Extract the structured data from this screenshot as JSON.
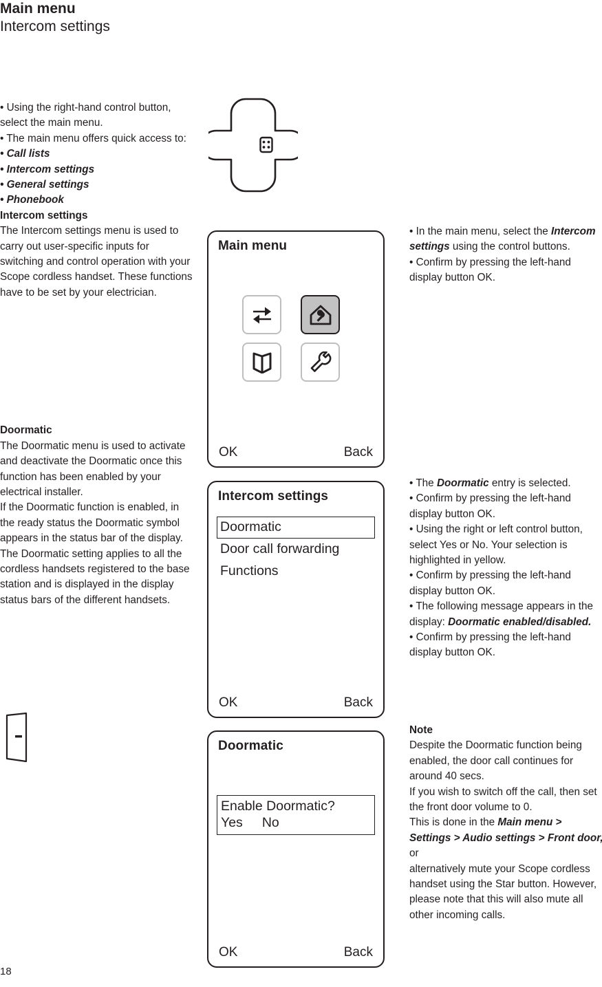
{
  "header": {
    "title": "Main menu",
    "subtitle": "Intercom settings"
  },
  "left_column": {
    "intro_bullets": [
      "• Using the right-hand control button, select the main menu.",
      "• The main menu offers quick access to:"
    ],
    "quick_access_items": [
      "• Call lists",
      "• Intercom settings",
      "• General settings",
      "• Phonebook"
    ],
    "section_intercom": {
      "heading": "Intercom settings",
      "body": "The Intercom settings menu is used to carry out user-specific inputs for switching and control operation with your Scope cordless handset. These functions have to be set by your electrician."
    },
    "section_doormatic": {
      "heading": "Doormatic",
      "paragraph1": "The Doormatic menu is used to activate and deactivate the Doormatic once this function has been enabled by your electrical installer.",
      "paragraph2": "If the Doormatic function is enabled, in the ready status the Doormatic symbol appears in the status bar of the display.",
      "paragraph3": "The Doormatic setting applies to all the cordless handsets registered to the base station and is displayed in the display status bars of the different handsets."
    }
  },
  "right_column": {
    "block1": {
      "line1_a": "• In the main menu, select the ",
      "line1_b": "Intercom settings",
      "line1_c": " using the control buttons.",
      "line2": "• Confirm by pressing the left-hand display button OK."
    },
    "block2": {
      "b1_a": "• The ",
      "b1_b": "Doormatic",
      "b1_c": " entry is selected.",
      "b2": "• Confirm by pressing the left-hand display button OK.",
      "b3": "• Using the right or left control button, select Yes or No. Your selection is highlighted in yellow.",
      "b4": "• Confirm by pressing the left-hand display button OK.",
      "b5_a": "• The following message appears in the display: ",
      "b5_b": "Doormatic enabled/disabled.",
      "b6": "• Confirm by pressing the left-hand display button OK."
    },
    "note": {
      "heading": "Note",
      "p1": "Despite the Doormatic function being enabled, the door call continues for around 40 secs.",
      "p2": "If you wish to switch off the call, then set the front door volume to 0.",
      "p3_a": "This is done in the ",
      "p3_b": "Main menu > Settings > Audio settings > Front door,",
      "p3_c": " or",
      "p4": "alternatively mute your Scope cordless handset using the Star button. However, please note that this will also mute all other incoming calls."
    }
  },
  "screens": {
    "main_menu": {
      "title": "Main menu",
      "softkey_left": "OK",
      "softkey_right": "Back",
      "tiles": [
        {
          "icon": "call-lists-icon",
          "label": "Call lists",
          "selected": false
        },
        {
          "icon": "intercom-settings-house-wrench-icon",
          "label": "Intercom settings",
          "selected": true
        },
        {
          "icon": "phonebook-icon",
          "label": "Phonebook",
          "selected": false
        },
        {
          "icon": "general-settings-wrench-icon",
          "label": "General settings",
          "selected": false
        }
      ]
    },
    "intercom_settings": {
      "title": "Intercom settings",
      "softkey_left": "OK",
      "softkey_right": "Back",
      "items": [
        {
          "label": "Doormatic",
          "highlighted": true
        },
        {
          "label": "Door call forwarding",
          "highlighted": false
        },
        {
          "label": "Functions",
          "highlighted": false
        }
      ]
    },
    "doormatic": {
      "title": "Doormatic",
      "softkey_left": "OK",
      "softkey_right": "Back",
      "question": "Enable Doormatic?",
      "option_yes": "Yes",
      "option_no": "No"
    }
  },
  "illustration": {
    "dpad_icon": "menu-grid-icon",
    "door_symbol": "doormatic-door-icon"
  },
  "footer": {
    "page_number": "18"
  },
  "colors": {
    "ink": "#231f20",
    "tile_border": "#bcbec0",
    "tile_selected_fill": "#c2c2c2"
  }
}
